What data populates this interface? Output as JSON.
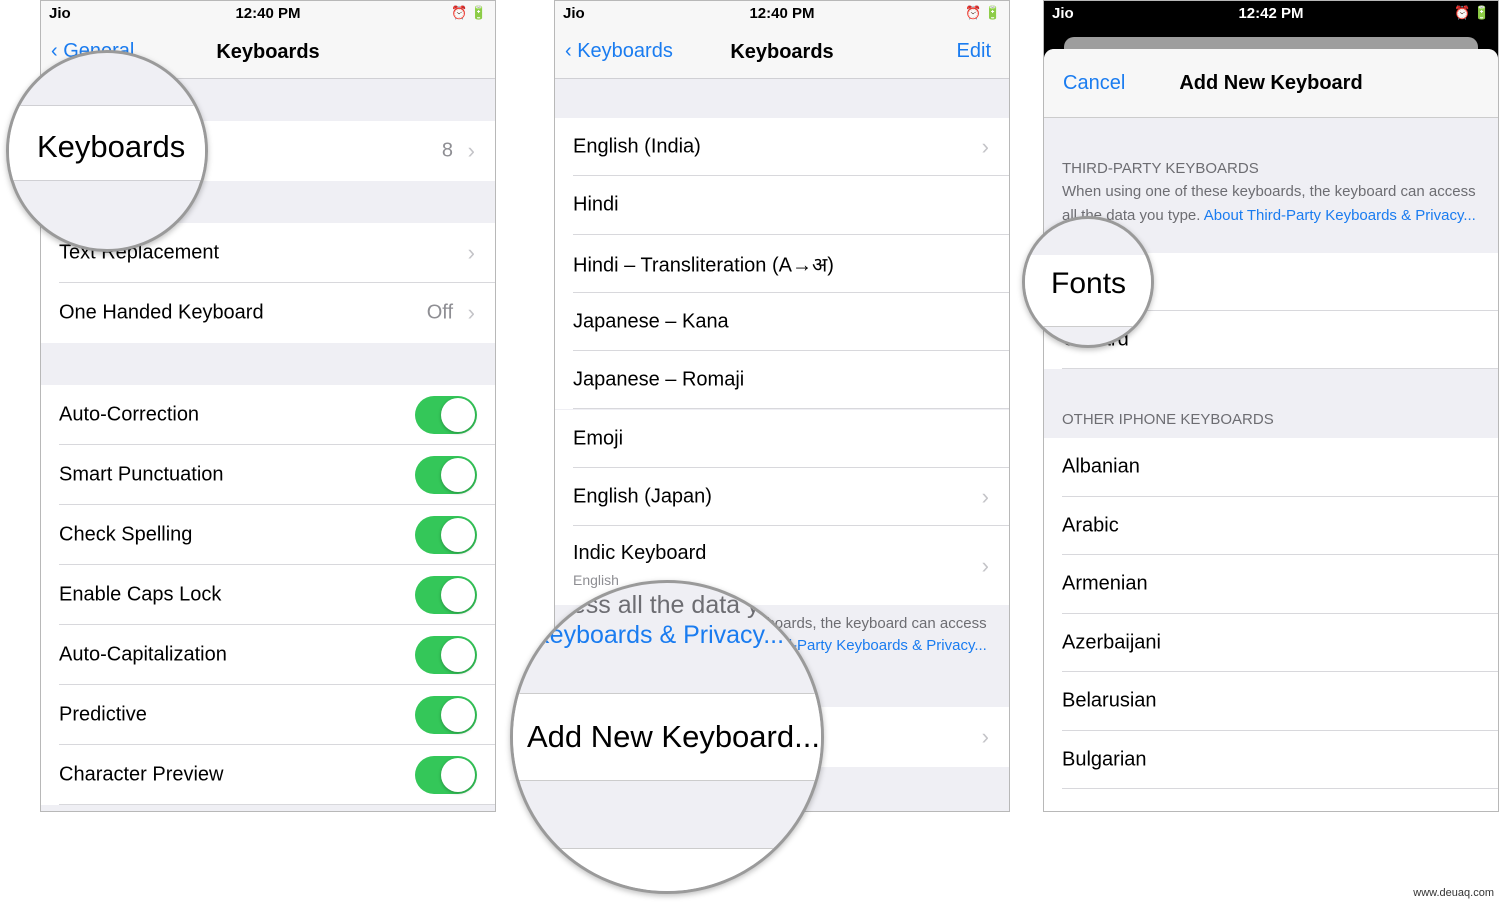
{
  "panel1": {
    "status": {
      "carrier": "Jio",
      "time": "12:40 PM"
    },
    "nav": {
      "back": "General",
      "title": "Keyboards"
    },
    "keyboards_row": {
      "label": "Keyboards",
      "value": "8"
    },
    "rows": [
      {
        "label": "Text Replacement",
        "value": ""
      },
      {
        "label": "One Handed Keyboard",
        "value": "Off"
      }
    ],
    "toggles": [
      {
        "label": "Auto-Correction",
        "on": true
      },
      {
        "label": "Smart Punctuation",
        "on": true
      },
      {
        "label": "Check Spelling",
        "on": true
      },
      {
        "label": "Enable Caps Lock",
        "on": true
      },
      {
        "label": "Auto-Capitalization",
        "on": true
      },
      {
        "label": "Predictive",
        "on": true
      },
      {
        "label": "Character Preview",
        "on": true
      }
    ],
    "magnifier": "Keyboards"
  },
  "panel2": {
    "status": {
      "carrier": "Jio",
      "time": "12:40 PM"
    },
    "nav": {
      "back": "Keyboards",
      "title": "Keyboards",
      "right": "Edit"
    },
    "keyboards": [
      {
        "label": "English (India)",
        "chevron": true
      },
      {
        "label": "Hindi",
        "chevron": false
      },
      {
        "label": "Hindi – Transliteration (A→अ)",
        "chevron": false
      },
      {
        "label": "Japanese – Kana",
        "chevron": false
      },
      {
        "label": "Japanese – Romaji",
        "chevron": false
      },
      {
        "label": "Emoji",
        "chevron": false
      },
      {
        "label": "English (Japan)",
        "chevron": true
      }
    ],
    "indic": {
      "label": "Indic Keyboard",
      "sub": "English"
    },
    "footer": {
      "text": "When using one of these keyboards, the keyboard can access all the data you type.",
      "link": "About Third-Party Keyboards & Privacy..."
    },
    "magnifier": {
      "line1": "access all the data you type.",
      "line2": "Keyboards & Privacy...",
      "add": "Add New Keyboard..."
    }
  },
  "panel3": {
    "status": {
      "carrier": "Jio",
      "time": "12:42 PM"
    },
    "header": {
      "cancel": "Cancel",
      "title": "Add New Keyboard"
    },
    "third_party": {
      "title": "THIRD-PARTY KEYBOARDS",
      "text": "When using one of these keyboards, the keyboard can access all the data you type.",
      "link": "About Third-Party Keyboards & Privacy..."
    },
    "third_party_rows": [
      "Fonts",
      "Gboard"
    ],
    "other_title": "OTHER IPHONE KEYBOARDS",
    "other_rows": [
      "Albanian",
      "Arabic",
      "Armenian",
      "Azerbaijani",
      "Belarusian",
      "Bulgarian"
    ],
    "magnifier": "Fonts"
  },
  "watermark": "www.deuaq.com",
  "colors": {
    "accent": "#1a7cf0",
    "toggle_on": "#34c759"
  }
}
